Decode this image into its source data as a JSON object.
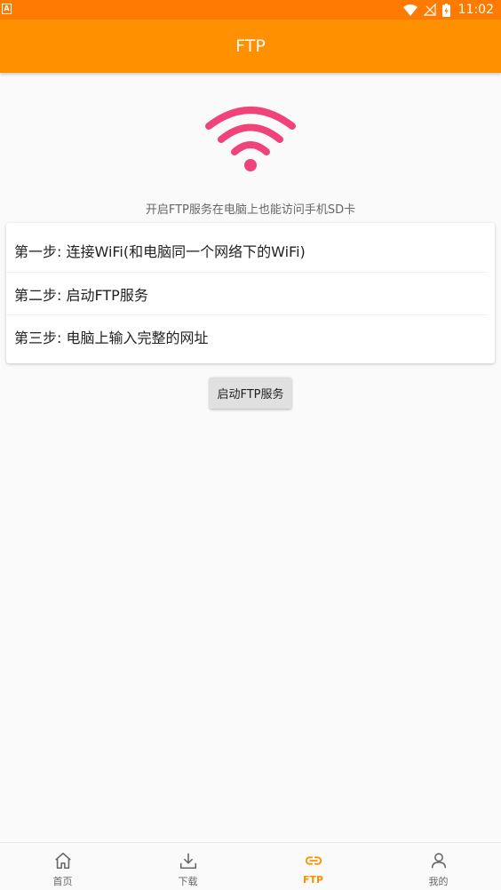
{
  "status_bar": {
    "time": "11:02",
    "left_icon_letter": "A"
  },
  "app_bar": {
    "title": "FTP"
  },
  "hero": {
    "icon": "wifi-icon",
    "icon_color": "#f0437a",
    "hint": "开启FTP服务在电脑上也能访问手机SD卡"
  },
  "steps": [
    {
      "label": "第一步: 连接WiFi(和电脑同一个网络下的WiFi)"
    },
    {
      "label": "第二步: 启动FTP服务"
    },
    {
      "label": "第三步: 电脑上输入完整的网址"
    }
  ],
  "start_button": {
    "label": "启动FTP服务"
  },
  "bottom_nav": {
    "active_color": "#ff9000",
    "items": [
      {
        "label": "首页",
        "icon": "home-icon"
      },
      {
        "label": "下载",
        "icon": "download-icon"
      },
      {
        "label": "FTP",
        "icon": "link-icon",
        "active": true
      },
      {
        "label": "我的",
        "icon": "person-icon"
      }
    ]
  },
  "colors": {
    "status_bar": "#ff7a00",
    "app_bar": "#ff9000"
  }
}
